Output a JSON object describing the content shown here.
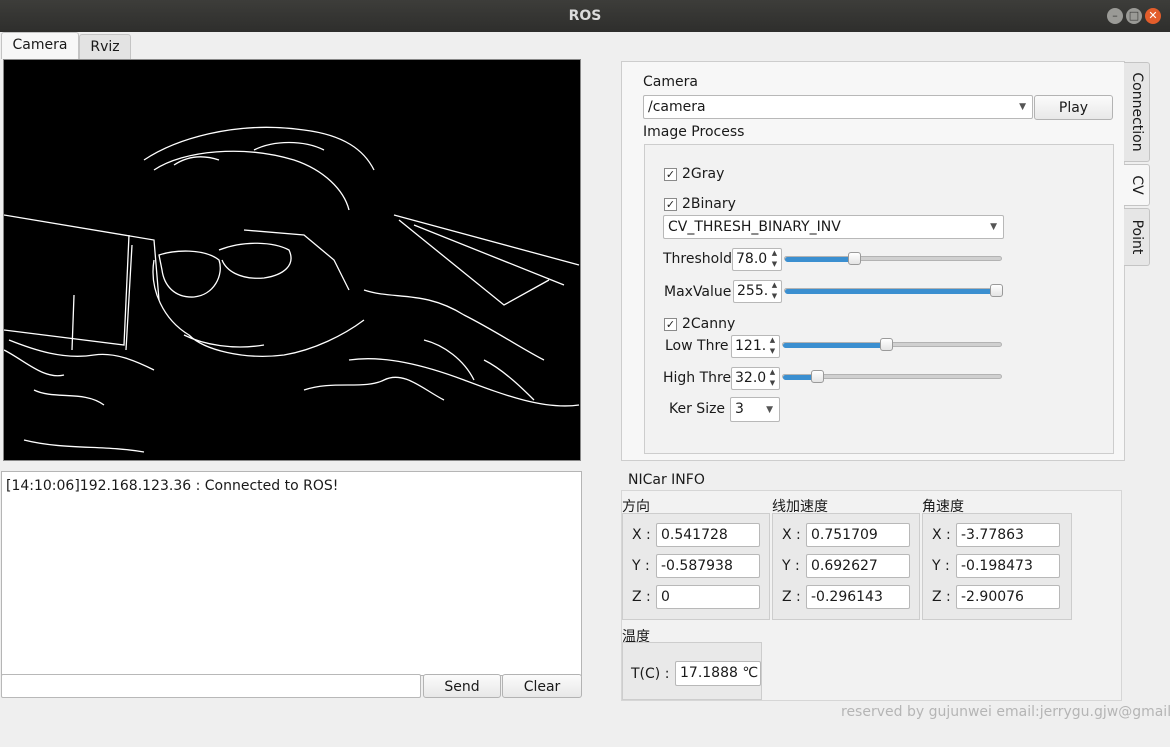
{
  "window": {
    "title": "ROS"
  },
  "left_tabs": [
    {
      "label": "Camera"
    },
    {
      "label": "Rviz"
    }
  ],
  "log": {
    "lines": [
      "[14:10:06]192.168.123.36 :  Connected to ROS!"
    ]
  },
  "send_bar": {
    "input_value": "",
    "send_label": "Send",
    "clear_label": "Clear"
  },
  "side_tabs": [
    {
      "label": "Connection"
    },
    {
      "label": "CV"
    },
    {
      "label": "Point"
    }
  ],
  "cv": {
    "camera_label": "Camera",
    "camera_topic": "/camera",
    "play_label": "Play",
    "image_process_label": "Image Process",
    "gray": {
      "label": "2Gray",
      "checked": true
    },
    "binary": {
      "label": "2Binary",
      "checked": true,
      "mode": "CV_THRESH_BINARY_INV"
    },
    "threshold": {
      "label": "Threshold",
      "value": "78.0",
      "fraction": 0.31
    },
    "maxvalue": {
      "label": "MaxValue",
      "value": "255.",
      "fraction": 1.0
    },
    "canny": {
      "label": "2Canny",
      "checked": true
    },
    "low_thre": {
      "label": "Low Thre",
      "value": "121.",
      "fraction": 0.47
    },
    "high_thre": {
      "label": "High Thre",
      "value": "32.0",
      "fraction": 0.14
    },
    "ker_size": {
      "label": "Ker Size",
      "value": "3"
    }
  },
  "nicar": {
    "title": "NICar INFO",
    "direction": {
      "label": "方向",
      "x": "0.541728",
      "y": "-0.587938",
      "z": "0"
    },
    "linear_acc": {
      "label": "线加速度",
      "x": "0.751709",
      "y": "0.692627",
      "z": "-0.296143"
    },
    "angular_vel": {
      "label": "角速度",
      "x": "-3.77863",
      "y": "-0.198473",
      "z": "-2.90076"
    },
    "axis_labels": {
      "x": "X :",
      "y": "Y :",
      "z": "Z :"
    },
    "temperature": {
      "label": "温度",
      "t_label": "T(C) :",
      "value": "17.1888 ℃"
    }
  },
  "footer": {
    "text": "reserved by gujunwei email:jerrygu.gjw@gmail."
  },
  "icons": {
    "check": "check-icon",
    "dropdown": "chevron-down-icon",
    "spin": "spin-arrows-icon"
  },
  "colors": {
    "accent": "#3b8fd0",
    "titlebar": "#2e2e2c",
    "close": "#e35d2b"
  }
}
